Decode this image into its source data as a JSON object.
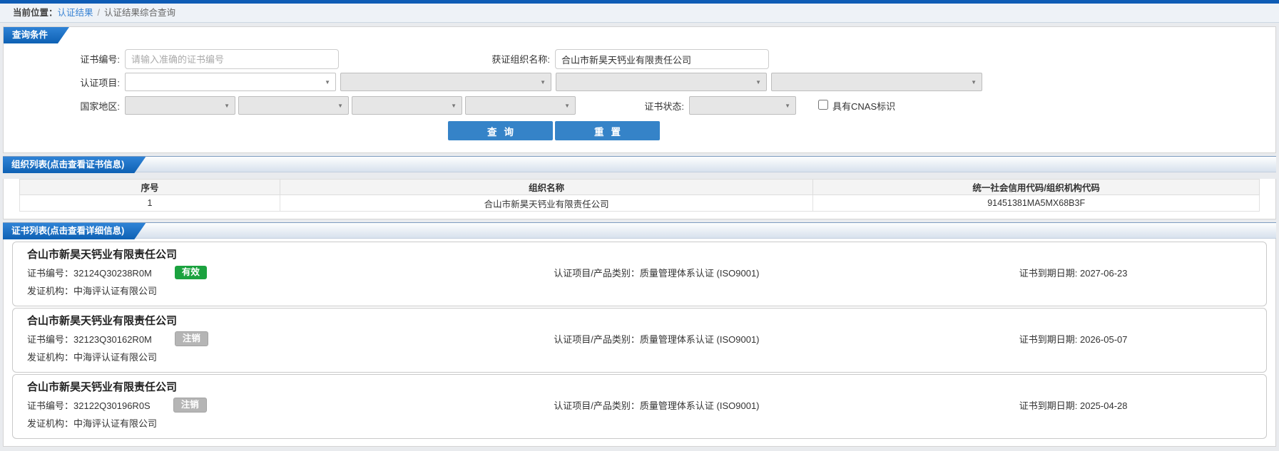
{
  "breadcrumb": {
    "prefix": "当前位置：",
    "link": "认证结果",
    "separator": "/",
    "current": "认证结果综合查询"
  },
  "icons": {
    "chevron_down": "▼"
  },
  "colors": {
    "topbar_blue": "#0e5cb5",
    "ribbon_blue": "#0e61b4",
    "link_blue": "#3a84d4",
    "button_blue": "#3583c8",
    "badge_green": "#1ba23f",
    "badge_gray": "#b5b5b5"
  },
  "query_panel": {
    "title": "查询条件",
    "cert_no_label": "证书编号:",
    "cert_no_placeholder": "请输入准确的证书编号",
    "org_name_label": "获证组织名称:",
    "org_name_value": "合山市新昊天钙业有限责任公司",
    "cert_project_label": "认证项目:",
    "region_label": "国家地区:",
    "cert_status_label": "证书状态:",
    "cnas_label": "具有CNAS标识",
    "search_button": "查询",
    "reset_button": "重置"
  },
  "org_section": {
    "title": "组织列表(点击查看证书信息)",
    "headers": [
      "序号",
      "组织名称",
      "统一社会信用代码/组织机构代码"
    ],
    "rows": [
      {
        "index": "1",
        "name": "合山市新昊天钙业有限责任公司",
        "code": "91451381MA5MX68B3F"
      }
    ]
  },
  "cert_section": {
    "title": "证书列表(点击查看详细信息)",
    "labels": {
      "cert_no": "证书编号：",
      "project": "认证项目/产品类别：",
      "expiry": "证书到期日期: ",
      "issuer": "发证机构："
    },
    "cards": [
      {
        "org": "合山市新昊天钙业有限责任公司",
        "cert_no": "32124Q30238R0M",
        "status": "有效",
        "project": "质量管理体系认证 (ISO9001)",
        "expiry": "2027-06-23",
        "issuer": "中海评认证有限公司"
      },
      {
        "org": "合山市新昊天钙业有限责任公司",
        "cert_no": "32123Q30162R0M",
        "status": "注销",
        "project": "质量管理体系认证 (ISO9001)",
        "expiry": "2026-05-07",
        "issuer": "中海评认证有限公司"
      },
      {
        "org": "合山市新昊天钙业有限责任公司",
        "cert_no": "32122Q30196R0S",
        "status": "注销",
        "project": "质量管理体系认证 (ISO9001)",
        "expiry": "2025-04-28",
        "issuer": "中海评认证有限公司"
      }
    ]
  }
}
